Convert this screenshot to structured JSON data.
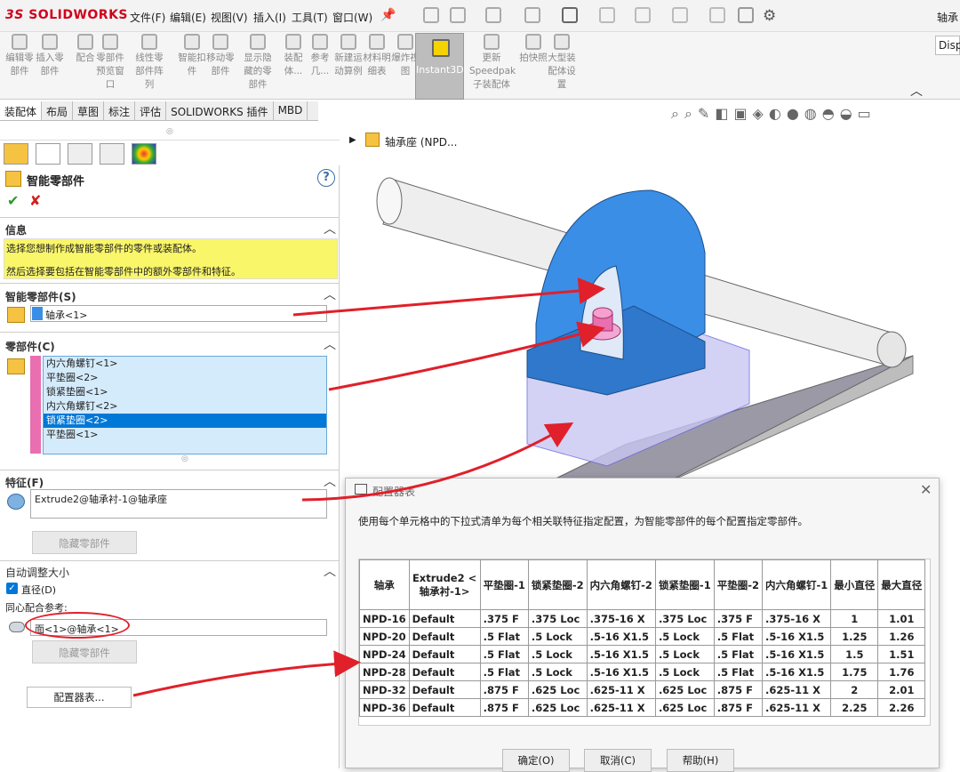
{
  "app": {
    "logo": "SOLIDWORKS",
    "doc_title": "轴承"
  },
  "menu": [
    "文件(F)",
    "编辑(E)",
    "视图(V)",
    "插入(I)",
    "工具(T)",
    "窗口(W)"
  ],
  "ribbon": {
    "buttons": [
      {
        "label": "编辑零部件",
        "icon": "edit-component-icon"
      },
      {
        "label": "插入零部件",
        "icon": "insert-component-icon"
      },
      {
        "label": "配合",
        "icon": "mate-icon"
      },
      {
        "label": "零部件预览窗口",
        "icon": "preview-window-icon"
      },
      {
        "label": "线性零部件阵列",
        "icon": "linear-pattern-icon"
      },
      {
        "label": "智能扣件",
        "icon": "smart-fastener-icon"
      },
      {
        "label": "移动零部件",
        "icon": "move-component-icon"
      },
      {
        "label": "显示隐藏的零部件",
        "icon": "show-hidden-icon"
      },
      {
        "label": "装配体...",
        "icon": "assembly-feature-icon"
      },
      {
        "label": "参考几...",
        "icon": "reference-geometry-icon"
      },
      {
        "label": "新建运动算例",
        "icon": "motion-study-icon"
      },
      {
        "label": "材料明细表",
        "icon": "bom-icon"
      },
      {
        "label": "爆炸视图",
        "icon": "explode-view-icon"
      }
    ],
    "instant3d": "Instant3D",
    "right_buttons": [
      {
        "label": "更新Speedpak子装配体",
        "icon": "speedpak-icon"
      },
      {
        "label": "拍快照",
        "icon": "snapshot-icon"
      },
      {
        "label": "大型装配体设置",
        "icon": "large-assembly-icon"
      }
    ],
    "disp": "Disp"
  },
  "tabs": [
    "装配体",
    "布局",
    "草图",
    "标注",
    "评估",
    "SOLIDWORKS 插件",
    "MBD"
  ],
  "panel": {
    "title": "智能零部件",
    "info_header": "信息",
    "info_line1": "选择您想制作成智能零部件的零件或装配体。",
    "info_line2": "然后选择要包括在智能零部件中的额外零部件和特征。",
    "smart_header": "智能零部件(S)",
    "smart_value": "轴承<1>",
    "components_header": "零部件(C)",
    "components": [
      "内六角螺钉<1>",
      "平垫圈<2>",
      "锁紧垫圈<1>",
      "内六角螺钉<2>",
      "锁紧垫圈<2>",
      "平垫圈<1>"
    ],
    "selected_index": 4,
    "features_header": "特征(F)",
    "feature_value": "Extrude2@轴承衬-1@轴承座",
    "hide_btn": "隐藏零部件",
    "autosize_header": "自动调整大小",
    "diameter_label": "直径(D)",
    "concentric_label": "同心配合参考:",
    "concentric_value": "面<1>@轴承<1>",
    "hide_btn2": "隐藏零部件",
    "config_btn": "配置器表..."
  },
  "tree": {
    "root": "轴承座 (NPD..."
  },
  "dialog": {
    "title": "配置器表",
    "desc": "使用每个单元格中的下拉式清单为每个相关联特征指定配置，为智能零部件的每个配置指定零部件。",
    "headers": [
      "轴承",
      "Extrude2 <轴承衬-1>",
      "平垫圈-1",
      "锁紧垫圈-2",
      "内六角螺钉-2",
      "锁紧垫圈-1",
      "平垫圈-2",
      "内六角螺钉-1",
      "最小直径",
      "最大直径"
    ],
    "rows": [
      [
        "NPD-16",
        "Default",
        ".375 F",
        ".375 Loc",
        ".375-16 X",
        ".375 Loc",
        ".375 F",
        ".375-16 X",
        "1",
        "1.01"
      ],
      [
        "NPD-20",
        "Default",
        ".5 Flat",
        ".5 Lock",
        ".5-16 X1.5",
        ".5 Lock",
        ".5 Flat",
        ".5-16 X1.5",
        "1.25",
        "1.26"
      ],
      [
        "NPD-24",
        "Default",
        ".5 Flat",
        ".5 Lock",
        ".5-16 X1.5",
        ".5 Lock",
        ".5 Flat",
        ".5-16 X1.5",
        "1.5",
        "1.51"
      ],
      [
        "NPD-28",
        "Default",
        ".5 Flat",
        ".5 Lock",
        ".5-16 X1.5",
        ".5 Lock",
        ".5 Flat",
        ".5-16 X1.5",
        "1.75",
        "1.76"
      ],
      [
        "NPD-32",
        "Default",
        ".875 F",
        ".625 Loc",
        ".625-11 X",
        ".625 Loc",
        ".875 F",
        ".625-11 X",
        "2",
        "2.01"
      ],
      [
        "NPD-36",
        "Default",
        ".875 F",
        ".625 Loc",
        ".625-11 X",
        ".625 Loc",
        ".875 F",
        ".625-11 X",
        "2.25",
        "2.26"
      ]
    ],
    "ok": "确定(O)",
    "cancel": "取消(C)",
    "help": "帮助(H)"
  },
  "colors": {
    "part_blue": "#3a8ee6",
    "highlight": "#f9f66a",
    "selection": "#0078d7",
    "annotation": "#e0202a"
  }
}
